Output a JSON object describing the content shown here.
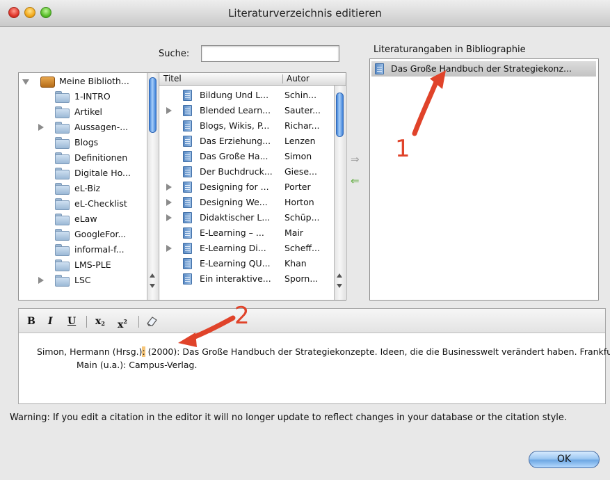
{
  "window": {
    "title": "Literaturverzeichnis editieren"
  },
  "search": {
    "label": "Suche:",
    "value": ""
  },
  "library": {
    "root": "Meine Biblioth...",
    "folders": [
      {
        "label": "1-INTRO",
        "expandable": false
      },
      {
        "label": "Artikel",
        "expandable": false
      },
      {
        "label": "Aussagen-...",
        "expandable": true
      },
      {
        "label": "Blogs",
        "expandable": false
      },
      {
        "label": "Definitionen",
        "expandable": false
      },
      {
        "label": "Digitale Ho...",
        "expandable": false
      },
      {
        "label": "eL-Biz",
        "expandable": false
      },
      {
        "label": "eL-Checklist",
        "expandable": false
      },
      {
        "label": "eLaw",
        "expandable": false
      },
      {
        "label": "GoogleFor...",
        "expandable": false
      },
      {
        "label": "informal-f...",
        "expandable": false
      },
      {
        "label": "LMS-PLE",
        "expandable": false
      },
      {
        "label": "LSC",
        "expandable": true
      }
    ]
  },
  "references": {
    "headers": {
      "title": "Titel",
      "author": "Autor"
    },
    "rows": [
      {
        "title": "Bildung Und L...",
        "author": "Schin...",
        "expandable": false
      },
      {
        "title": "Blended Learn...",
        "author": "Sauter...",
        "expandable": true
      },
      {
        "title": "Blogs, Wikis, P...",
        "author": "Richar...",
        "expandable": false
      },
      {
        "title": "Das Erziehung...",
        "author": "Lenzen",
        "expandable": false
      },
      {
        "title": "Das Große Ha...",
        "author": "Simon",
        "expandable": false
      },
      {
        "title": "Der Buchdruck...",
        "author": "Giese...",
        "expandable": false
      },
      {
        "title": "Designing for ...",
        "author": "Porter",
        "expandable": true
      },
      {
        "title": "Designing We...",
        "author": "Horton",
        "expandable": true
      },
      {
        "title": "Didaktischer L...",
        "author": "Schüp...",
        "expandable": true
      },
      {
        "title": "E-Learning – ...",
        "author": "Mair",
        "expandable": false
      },
      {
        "title": "E-Learning Di...",
        "author": "Scheff...",
        "expandable": true
      },
      {
        "title": "E-Learning QU...",
        "author": "Khan",
        "expandable": false
      },
      {
        "title": "Ein interaktive...",
        "author": "Sporn...",
        "expandable": false
      }
    ]
  },
  "move_buttons": {
    "add_arrow": "⇒",
    "remove_arrow": "⇐"
  },
  "bibliography": {
    "label": "Literaturangaben in Bibliographie",
    "items": [
      "Das Große Handbuch der Strategiekonz..."
    ]
  },
  "editor": {
    "toolbar": {
      "bold": "B",
      "italic": "I",
      "underline": "U",
      "subscript": "x",
      "superscript": "x",
      "sub_marker": "2",
      "sup_marker": "2"
    },
    "citation_before": "Simon, Hermann (Hrsg.)",
    "citation_highlight": ":",
    "citation_after": " (2000): Das Große Handbuch der Strategiekonzepte. Ideen, die die Businesswelt verändert haben. Frankfurt am Main (u.a.): Campus-Verlag."
  },
  "warning": "Warning: If you edit a citation in the editor it will no longer update to reflect changes in your database or the citation style.",
  "ok_button": "OK",
  "annotations": {
    "marker_1": "1",
    "marker_2": "2",
    "color": "#e0432a"
  }
}
